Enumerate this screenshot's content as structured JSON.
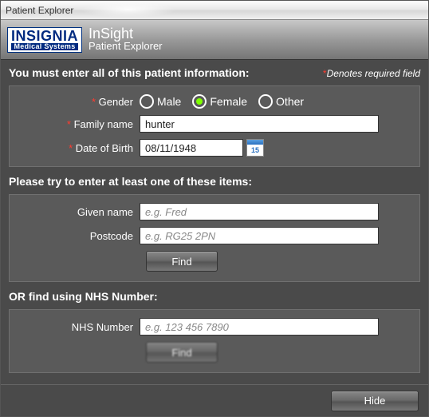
{
  "window": {
    "title": "Patient Explorer"
  },
  "brand": {
    "line1": "INSIGNIA",
    "line2": "Medical Systems",
    "app": "InSight",
    "subtitle": "Patient Explorer"
  },
  "required": {
    "heading": "You must enter all of this patient information:",
    "note_star": "*",
    "note": "Denotes required field"
  },
  "gender": {
    "label": "Gender",
    "options": {
      "male": "Male",
      "female": "Female",
      "other": "Other"
    },
    "selected": "female"
  },
  "family_name": {
    "label": "Family name",
    "value": "hunter"
  },
  "dob": {
    "label": "Date of Birth",
    "value": "08/11/1948",
    "cal_day": "15"
  },
  "optional_heading": "Please try to enter at least one of these items:",
  "given_name": {
    "label": "Given name",
    "placeholder": "e.g. Fred",
    "value": ""
  },
  "postcode": {
    "label": "Postcode",
    "placeholder": "e.g. RG25 2PN",
    "value": ""
  },
  "find1": "Find",
  "nhs_heading": "OR find using NHS Number:",
  "nhs": {
    "label": "NHS Number",
    "placeholder": "e.g. 123 456 7890",
    "value": ""
  },
  "find2": "Find",
  "hide": "Hide"
}
